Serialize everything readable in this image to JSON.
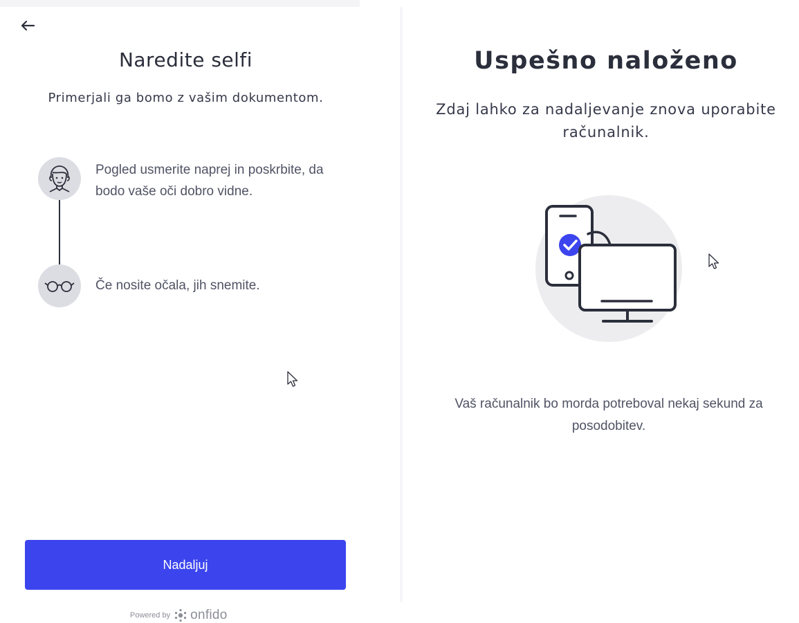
{
  "selfie_screen": {
    "back_icon": "arrow-left-icon",
    "title": "Naredite selfi",
    "subtitle": "Primerjali ga bomo z vašim dokumentom.",
    "steps": [
      {
        "icon": "face-icon",
        "text": "Pogled usmerite naprej in poskrbite, da bodo vaše oči dobro vidne."
      },
      {
        "icon": "glasses-icon",
        "text": "Če nosite očala, jih snemite."
      }
    ],
    "continue_label": "Nadaljuj",
    "powered_by": "Powered by",
    "brand": "onfido"
  },
  "upload_screen": {
    "title": "Uspešno naloženo",
    "subtitle": "Zdaj lahko za nadaljevanje znova uporabite računalnik.",
    "illustration_icon": "phone-to-computer-icon",
    "note": "Vaš računalnik bo morda potreboval nekaj sekund za posodobitev."
  },
  "colors": {
    "primary_button": "#3c44ee",
    "text_dark": "#2b2e3b",
    "icon_circle": "#dcdde2",
    "check_accent": "#3c44ee"
  }
}
